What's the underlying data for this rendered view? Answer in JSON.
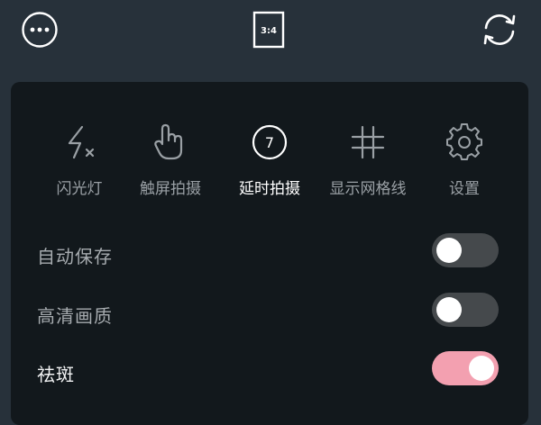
{
  "toolbar": {
    "more_icon": "more-horizontal-circle-icon",
    "ratio_label": "3:4",
    "rotate_icon": "camera-switch-icon"
  },
  "modes": [
    {
      "label": "闪光灯",
      "icon": "flash-off-icon",
      "active": false
    },
    {
      "label": "触屏拍摄",
      "icon": "touch-hand-icon",
      "active": false
    },
    {
      "label": "延时拍摄",
      "icon": "timer-circle-icon",
      "icon_text": "7",
      "active": true
    },
    {
      "label": "显示网格线",
      "icon": "grid-hash-icon",
      "active": false
    },
    {
      "label": "设置",
      "icon": "gear-icon",
      "active": false
    }
  ],
  "settings": [
    {
      "label": "自动保存",
      "enabled": false
    },
    {
      "label": "高清画质",
      "enabled": false
    },
    {
      "label": "祛斑",
      "enabled": true
    }
  ],
  "colors": {
    "background": "#27313a",
    "panel": "#12181c",
    "toggle_off": "#45494c",
    "toggle_on": "#f3a0b0",
    "label_active": "#ffffff",
    "label_inactive": "#9aa0a5"
  }
}
